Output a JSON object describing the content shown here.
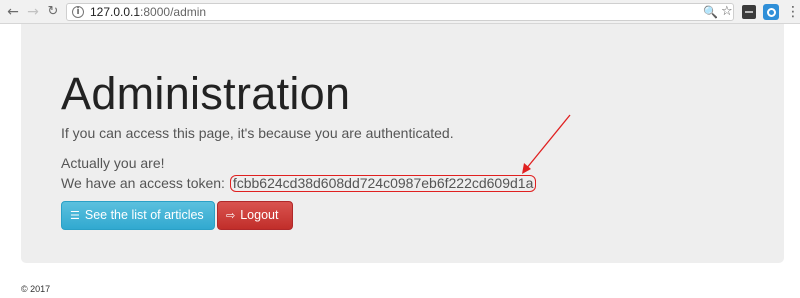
{
  "browser": {
    "back_glyph": "←",
    "forward_glyph": "→",
    "reload_glyph": "↻",
    "url_host": "127.0.0.1",
    "url_rest": ":8000/admin",
    "page_icon_glyph": "i",
    "zoom_icon": "zoom-icon",
    "zoom_glyph": "🔍",
    "star_glyph": "☆",
    "menu_glyph": "⋮"
  },
  "page": {
    "title": "Administration",
    "lead": "If you can access this page, it's because you are authenticated.",
    "line1": "Actually you are!",
    "token_label": "We have an access token:",
    "token": "fcbb624cd38d608dd724c0987eb6f222cd609d1a",
    "buttons": {
      "articles_label": "See the list of articles",
      "articles_icon_glyph": "☰",
      "logout_label": "Logout",
      "logout_icon_glyph": "⇨"
    },
    "annotation": {
      "color": "#e02020"
    }
  },
  "footer": {
    "copyright": "© 2017"
  },
  "colors": {
    "jumbotron_bg": "#eeeeee",
    "info_button": "#5bc0de",
    "danger_button": "#d9534f",
    "annotation_red": "#e02020"
  }
}
